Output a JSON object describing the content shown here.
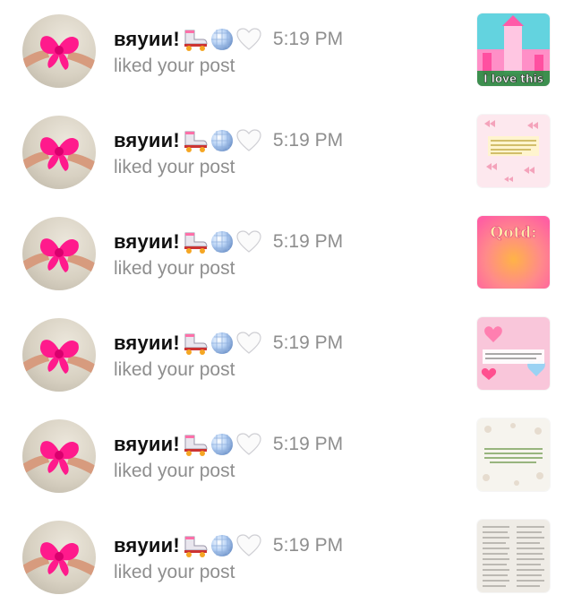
{
  "notifications": [
    {
      "username": "вяуии!",
      "time": "5:19 PM",
      "action": "liked your post",
      "thumb_icon": "pink-castle-image",
      "thumb_caption": "I love this"
    },
    {
      "username": "вяуии!",
      "time": "5:19 PM",
      "action": "liked your post",
      "thumb_icon": "bows-pattern-image"
    },
    {
      "username": "вяуии!",
      "time": "5:19 PM",
      "action": "liked your post",
      "thumb_icon": "gradient-image",
      "thumb_caption": "Qotd:"
    },
    {
      "username": "вяуии!",
      "time": "5:19 PM",
      "action": "liked your post",
      "thumb_icon": "pink-hearts-collage-image"
    },
    {
      "username": "вяуии!",
      "time": "5:19 PM",
      "action": "liked your post",
      "thumb_icon": "floral-text-image"
    },
    {
      "username": "вяуии!",
      "time": "5:19 PM",
      "action": "liked your post",
      "thumb_icon": "text-list-image"
    }
  ],
  "emoji_icons": [
    "roller-skate-icon",
    "disco-ball-icon",
    "white-heart-icon"
  ],
  "colors": {
    "username": "#111111",
    "secondary_text": "#8e8e8e",
    "background": "#ffffff"
  }
}
